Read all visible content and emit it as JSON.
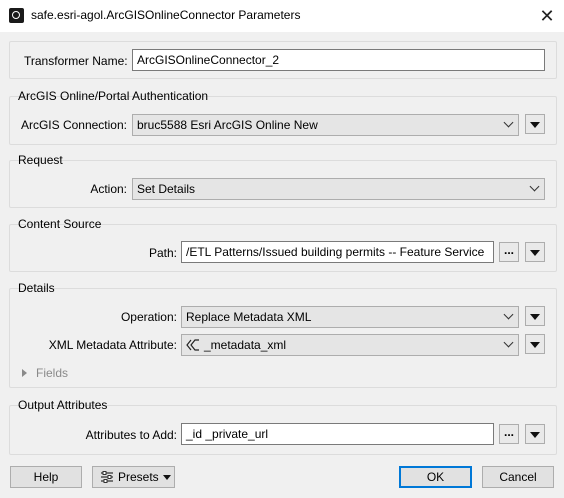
{
  "window": {
    "title": "safe.esri-agol.ArcGISOnlineConnector Parameters",
    "app_icon": "fme-app-icon",
    "close_icon": "close-icon"
  },
  "transformer": {
    "label": "Transformer Name:",
    "value": "ArcGISOnlineConnector_2"
  },
  "auth": {
    "title": "ArcGIS Online/Portal Authentication",
    "connection_label": "ArcGIS Connection:",
    "connection_value": "bruc5588 Esri ArcGIS Online New"
  },
  "request": {
    "title": "Request",
    "action_label": "Action:",
    "action_value": "Set Details"
  },
  "content_source": {
    "title": "Content Source",
    "path_label": "Path:",
    "path_value": "/ETL Patterns/Issued building permits -- Feature Service",
    "browse_label": "..."
  },
  "details": {
    "title": "Details",
    "operation_label": "Operation:",
    "operation_value": "Replace Metadata XML",
    "xml_label": "XML Metadata Attribute:",
    "xml_value": "_metadata_xml",
    "fields_label": "Fields"
  },
  "output": {
    "title": "Output Attributes",
    "attrs_label": "Attributes to Add:",
    "attrs_value": "_id _private_url",
    "browse_label": "..."
  },
  "footer": {
    "help": "Help",
    "presets": "Presets",
    "ok": "OK",
    "cancel": "Cancel"
  },
  "colors": {
    "accent": "#0078d7",
    "background": "#f0f0f0"
  }
}
